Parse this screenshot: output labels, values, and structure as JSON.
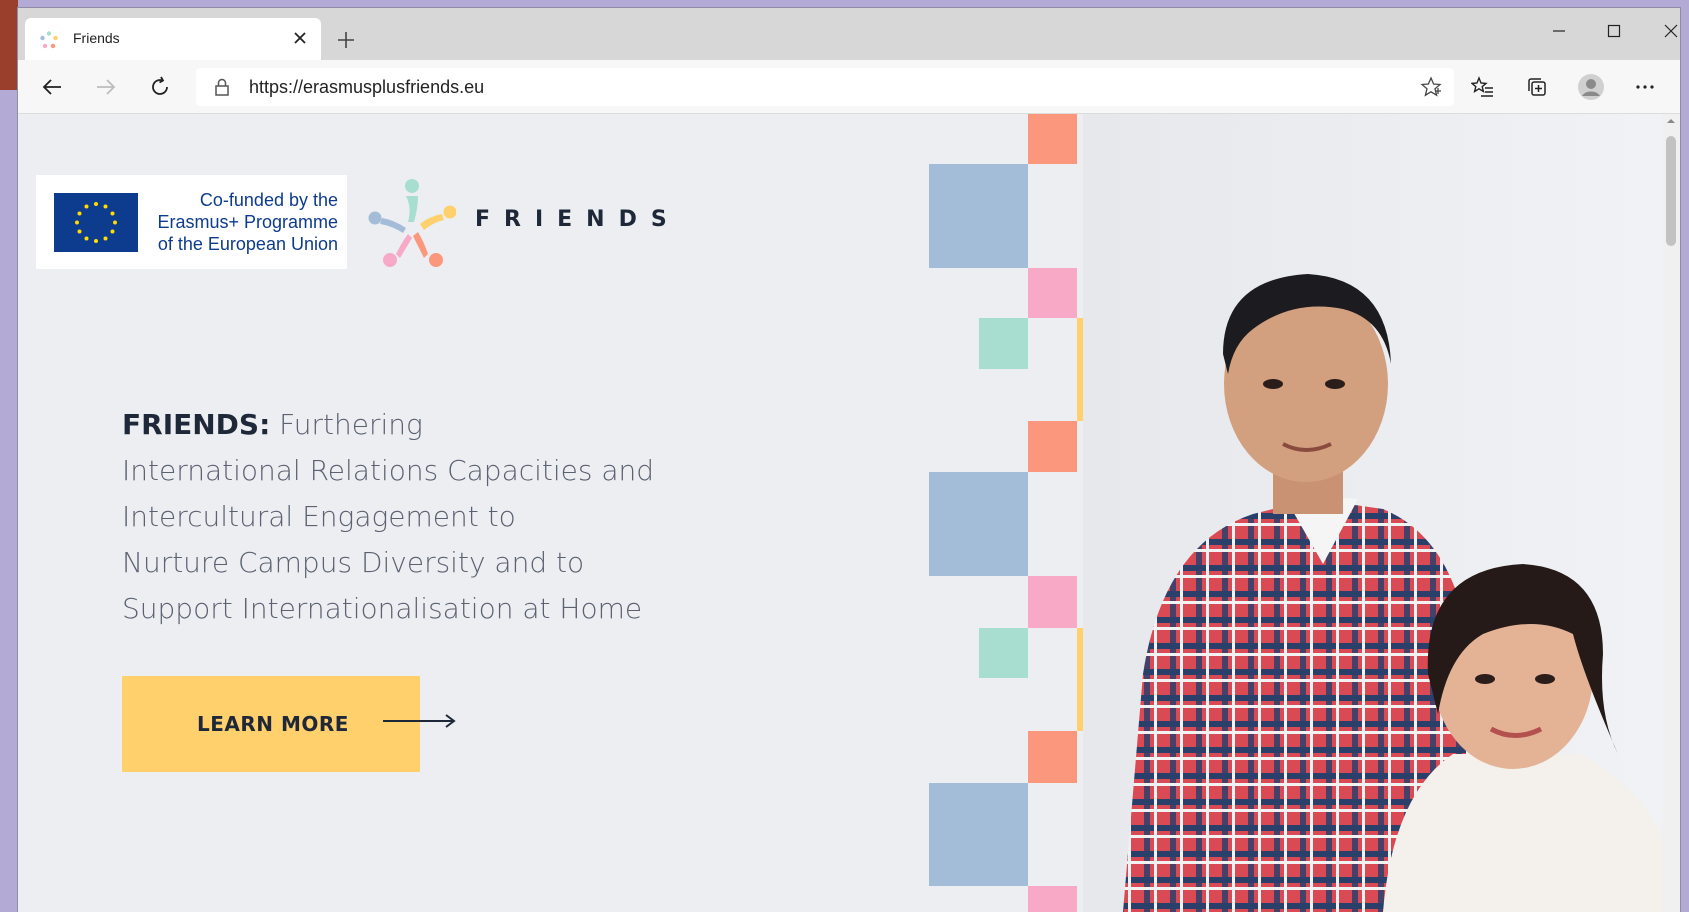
{
  "browser": {
    "tab": {
      "title": "Friends"
    },
    "address": {
      "url": "https://erasmusplusfriends.eu"
    },
    "icons": {
      "favicon": "friends-favicon-icon",
      "close": "close-icon",
      "new_tab": "plus-icon",
      "back": "back-arrow-icon",
      "forward": "forward-arrow-icon",
      "refresh": "refresh-icon",
      "lock": "lock-icon",
      "favorite": "star-icon",
      "favorites": "favorites-list-icon",
      "collections": "collections-icon",
      "profile": "profile-icon",
      "more": "more-icon"
    }
  },
  "page": {
    "eu_badge": {
      "line1": "Co-funded by the",
      "line2": "Erasmus+ Programme",
      "line3": "of the European Union"
    },
    "logo": {
      "wordmark": "FRIENDS"
    },
    "hero": {
      "title_strong": "FRIENDS:",
      "title_rest_1": " Furthering",
      "line2": "International Relations Capacities and",
      "line3": "Intercultural Engagement to",
      "line4": "Nurture Campus Diversity and to",
      "line5": "Support Internationalisation at Home"
    },
    "cta": {
      "label": "LEARN MORE"
    }
  },
  "colors": {
    "accent_yellow": "#ffd06b",
    "accent_blue": "#a3bdd8",
    "accent_salmon": "#fb977c",
    "accent_pink": "#f8a9c5",
    "accent_mint": "#a8ded0",
    "text_dark": "#1e2838",
    "eu_blue": "#0d3b8e"
  }
}
